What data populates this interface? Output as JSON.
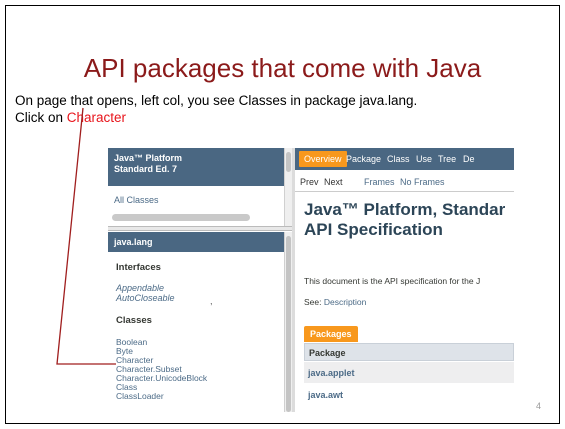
{
  "slide": {
    "title": "API packages that come with Java",
    "body_line1": "On page that opens, left col, you see Classes in package java.lang.",
    "body_click": "Click on ",
    "body_highlight": "Character",
    "page_number": "4"
  },
  "colors": {
    "title": "#8b1a1a",
    "highlight": "#e8141b",
    "pointer_line": "#a01e1e",
    "javadoc_header": "#4a6782",
    "javadoc_tab": "#f8981d",
    "javadoc_link": "#4c6b87"
  },
  "javadoc": {
    "left_top": {
      "header_line1": "Java™ Platform",
      "header_line2": "Standard Ed. 7",
      "all_classes": "All Classes"
    },
    "left_bottom": {
      "package_header": "java.lang",
      "interfaces_heading": "Interfaces",
      "interfaces": [
        "Appendable",
        "AutoCloseable"
      ],
      "classes_heading": "Classes",
      "classes": [
        "Boolean",
        "Byte",
        "Character",
        "Character.Subset",
        "Character.UnicodeBlock",
        "Class",
        "ClassLoader"
      ]
    },
    "right": {
      "top_nav": {
        "overview": "Overview",
        "package": "Package",
        "class": "Class",
        "use": "Use",
        "tree": "Tree",
        "deprecated_partial": "De"
      },
      "sub_nav": {
        "prev": "Prev",
        "next": "Next",
        "frames": "Frames",
        "no_frames": "No Frames"
      },
      "title_line1": "Java™ Platform, Standar",
      "title_line2": "API Specification",
      "description": "This document is the API specification for the J",
      "see_label": "See: ",
      "see_link": "Description",
      "packages_tab": "Packages",
      "table_header": "Package",
      "packages": [
        "java.applet",
        "java.awt"
      ]
    }
  }
}
